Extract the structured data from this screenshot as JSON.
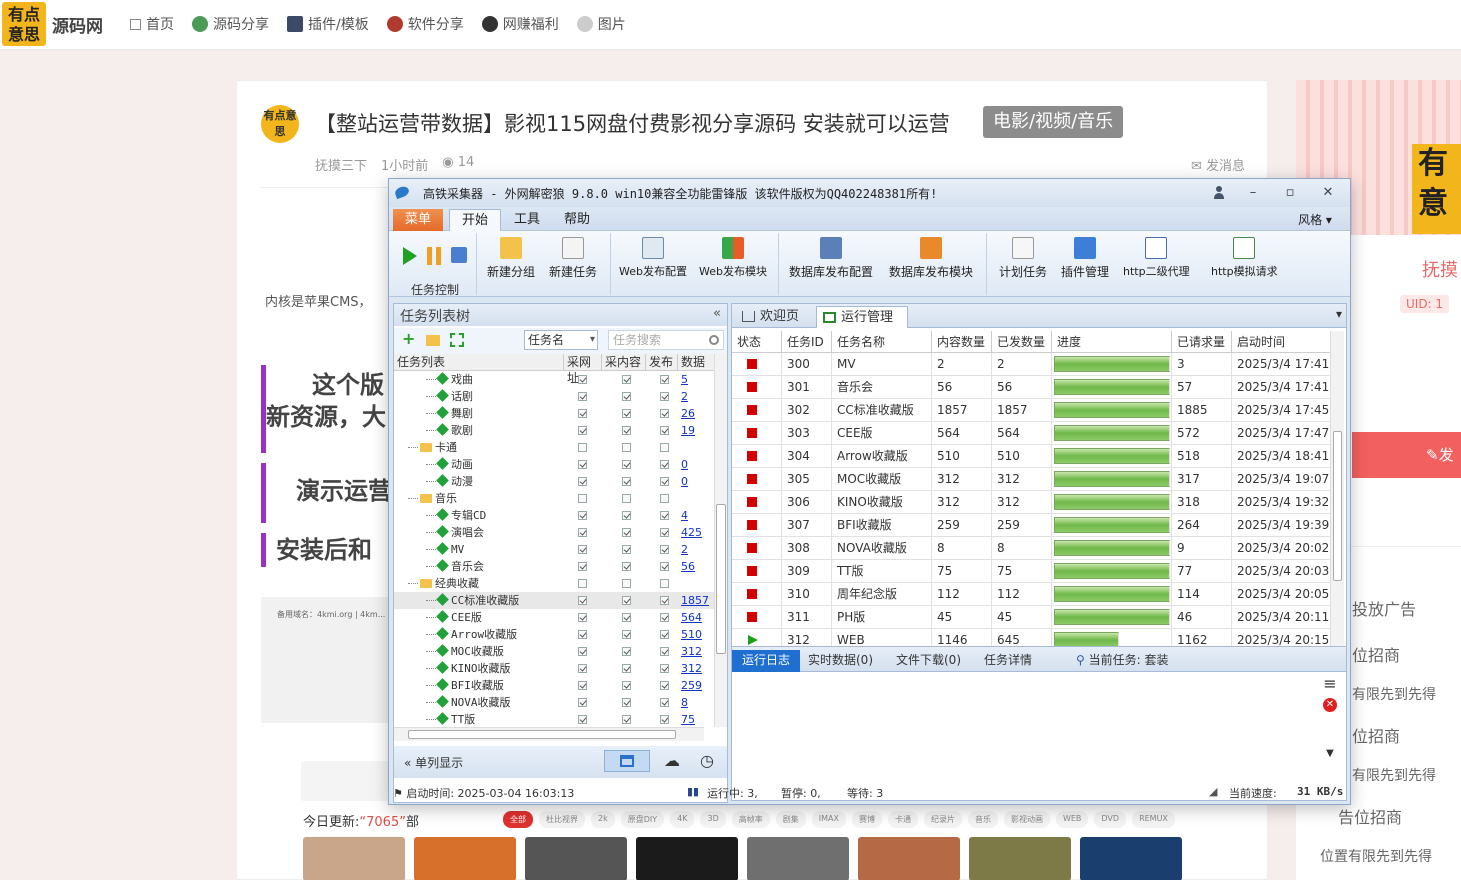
{
  "site": {
    "logo_text": "有点意思",
    "name": "源码网",
    "nav": [
      {
        "label": "首页",
        "icon": "home-icon"
      },
      {
        "label": "源码分享",
        "icon": "code-icon"
      },
      {
        "label": "插件/模板",
        "icon": "plugin-icon"
      },
      {
        "label": "软件分享",
        "icon": "software-icon"
      },
      {
        "label": "网赚福利",
        "icon": "gift-icon"
      },
      {
        "label": "图片",
        "icon": "image-icon"
      }
    ]
  },
  "article": {
    "title": "【整站运营带数据】影视115网盘付费影视分享源码 安装就可以运营",
    "tag": "电影/视频/音乐",
    "author": "抚摸三下",
    "time": "1小时前",
    "views": "14",
    "message": "发消息",
    "kernel_text": "内核是苹果CMS，",
    "headline1_line1": "这个版",
    "headline1_line2": "新资源，大",
    "headline2": "演示运营",
    "headline3": "安装后和",
    "img_caption": "备用域名：4kmi.org | 4km...",
    "today_label": "今日更新:",
    "today_count": "“7065”",
    "today_unit": "部",
    "chips": [
      "全部",
      "杜比视界",
      "2k",
      "原盘DIY",
      "4K",
      "3D",
      "高帧率",
      "剧集",
      "IMAX",
      "赛博",
      "卡通",
      "纪录片",
      "音乐",
      "影视动画",
      "WEB",
      "DVD",
      "REMUX"
    ]
  },
  "sidebar": {
    "name": "抚摸",
    "uid": "UID: 1",
    "post_btn": "发",
    "ads": [
      "投放广告",
      "位招商",
      "有限先到先得",
      "位招商",
      "有限先到先得",
      "告位招商",
      "位置有限先到先得"
    ]
  },
  "app": {
    "title": "高铁采集器 - 外网解密狼 9.8.0 win10兼容全功能雷锋版  该软件版权为QQ402248381所有!",
    "menu": {
      "menu": "菜单",
      "start": "开始",
      "tools": "工具",
      "help": "帮助",
      "style": "风格"
    },
    "ribbon": {
      "task_control": "任务控制",
      "new_group": "新建分组",
      "new_task": "新建任务",
      "web_config": "Web发布配置",
      "web_module": "Web发布模块",
      "db_config": "数据库发布配置",
      "db_module": "数据库发布模块",
      "schedule": "计划任务",
      "plugins": "插件管理",
      "http_proxy": "http二级代理",
      "http_sim": "http模拟请求"
    },
    "left": {
      "header": "任务列表树",
      "select": "任务名",
      "search_placeholder": "任务搜索",
      "cols": [
        "任务列表",
        "采网址",
        "采内容",
        "发布",
        "数据"
      ],
      "single_display": "单列显示",
      "start_time": "启动时间: 2025-03-04 16:03:13",
      "tree": [
        {
          "name": "戏曲",
          "level": 2,
          "folder": false,
          "c": [
            1,
            1,
            1
          ],
          "num": "5"
        },
        {
          "name": "话剧",
          "level": 2,
          "folder": false,
          "c": [
            1,
            1,
            1
          ],
          "num": "2"
        },
        {
          "name": "舞剧",
          "level": 2,
          "folder": false,
          "c": [
            1,
            1,
            1
          ],
          "num": "26"
        },
        {
          "name": "歌剧",
          "level": 2,
          "folder": false,
          "c": [
            1,
            1,
            1
          ],
          "num": "19"
        },
        {
          "name": "卡通",
          "level": 1,
          "folder": true,
          "c": [
            0,
            0,
            0
          ],
          "num": ""
        },
        {
          "name": "动画",
          "level": 2,
          "folder": false,
          "c": [
            1,
            1,
            1
          ],
          "num": "0"
        },
        {
          "name": "动漫",
          "level": 2,
          "folder": false,
          "c": [
            1,
            1,
            1
          ],
          "num": "0"
        },
        {
          "name": "音乐",
          "level": 1,
          "folder": true,
          "c": [
            0,
            0,
            0
          ],
          "num": ""
        },
        {
          "name": "专辑CD",
          "level": 2,
          "folder": false,
          "c": [
            1,
            1,
            1
          ],
          "num": "4"
        },
        {
          "name": "演唱会",
          "level": 2,
          "folder": false,
          "c": [
            1,
            1,
            1
          ],
          "num": "425"
        },
        {
          "name": "MV",
          "level": 2,
          "folder": false,
          "c": [
            1,
            1,
            1
          ],
          "num": "2"
        },
        {
          "name": "音乐会",
          "level": 2,
          "folder": false,
          "c": [
            1,
            1,
            1
          ],
          "num": "56"
        },
        {
          "name": "经典收藏",
          "level": 1,
          "folder": true,
          "c": [
            0,
            0,
            0
          ],
          "num": ""
        },
        {
          "name": "CC标准收藏版",
          "level": 2,
          "folder": false,
          "c": [
            1,
            1,
            1
          ],
          "num": "1857",
          "selected": true
        },
        {
          "name": "CEE版",
          "level": 2,
          "folder": false,
          "c": [
            1,
            1,
            1
          ],
          "num": "564"
        },
        {
          "name": "Arrow收藏版",
          "level": 2,
          "folder": false,
          "c": [
            1,
            1,
            1
          ],
          "num": "510"
        },
        {
          "name": "MOC收藏版",
          "level": 2,
          "folder": false,
          "c": [
            1,
            1,
            1
          ],
          "num": "312"
        },
        {
          "name": "KINO收藏版",
          "level": 2,
          "folder": false,
          "c": [
            1,
            1,
            1
          ],
          "num": "312"
        },
        {
          "name": "BFI收藏版",
          "level": 2,
          "folder": false,
          "c": [
            1,
            1,
            1
          ],
          "num": "259"
        },
        {
          "name": "NOVA收藏版",
          "level": 2,
          "folder": false,
          "c": [
            1,
            1,
            1
          ],
          "num": "8"
        },
        {
          "name": "TT版",
          "level": 2,
          "folder": false,
          "c": [
            1,
            1,
            1
          ],
          "num": "75"
        }
      ]
    },
    "right": {
      "tab_home": "欢迎页",
      "tab_run": "运行管理",
      "cols": [
        "状态",
        "任务ID",
        "任务名称",
        "内容数量",
        "已发数量",
        "进度",
        "已请求量",
        "启动时间"
      ],
      "rows": [
        {
          "status": "stopped",
          "id": "300",
          "name": "MV",
          "content": "2",
          "sent": "2",
          "progress": 1.0,
          "req": "3",
          "start": "2025/3/4 17:41:..."
        },
        {
          "status": "stopped",
          "id": "301",
          "name": "音乐会",
          "content": "56",
          "sent": "56",
          "progress": 1.0,
          "req": "57",
          "start": "2025/3/4 17:41:..."
        },
        {
          "status": "stopped",
          "id": "302",
          "name": "CC标准收藏版",
          "content": "1857",
          "sent": "1857",
          "progress": 1.0,
          "req": "1885",
          "start": "2025/3/4 17:45:..."
        },
        {
          "status": "stopped",
          "id": "303",
          "name": "CEE版",
          "content": "564",
          "sent": "564",
          "progress": 1.0,
          "req": "572",
          "start": "2025/3/4 17:47:..."
        },
        {
          "status": "stopped",
          "id": "304",
          "name": "Arrow收藏版",
          "content": "510",
          "sent": "510",
          "progress": 1.0,
          "req": "518",
          "start": "2025/3/4 18:41:..."
        },
        {
          "status": "stopped",
          "id": "305",
          "name": "MOC收藏版",
          "content": "312",
          "sent": "312",
          "progress": 1.0,
          "req": "317",
          "start": "2025/3/4 19:07:..."
        },
        {
          "status": "stopped",
          "id": "306",
          "name": "KINO收藏版",
          "content": "312",
          "sent": "312",
          "progress": 1.0,
          "req": "318",
          "start": "2025/3/4 19:32:..."
        },
        {
          "status": "stopped",
          "id": "307",
          "name": "BFI收藏版",
          "content": "259",
          "sent": "259",
          "progress": 1.0,
          "req": "264",
          "start": "2025/3/4 19:39:..."
        },
        {
          "status": "stopped",
          "id": "308",
          "name": "NOVA收藏版",
          "content": "8",
          "sent": "8",
          "progress": 1.0,
          "req": "9",
          "start": "2025/3/4 20:02:..."
        },
        {
          "status": "stopped",
          "id": "309",
          "name": "TT版",
          "content": "75",
          "sent": "75",
          "progress": 1.0,
          "req": "77",
          "start": "2025/3/4 20:03:..."
        },
        {
          "status": "stopped",
          "id": "310",
          "name": "周年纪念版",
          "content": "112",
          "sent": "112",
          "progress": 1.0,
          "req": "114",
          "start": "2025/3/4 20:05:..."
        },
        {
          "status": "stopped",
          "id": "311",
          "name": "PH版",
          "content": "45",
          "sent": "45",
          "progress": 1.0,
          "req": "46",
          "start": "2025/3/4 20:11:..."
        },
        {
          "status": "running",
          "id": "312",
          "name": "WEB",
          "content": "1146",
          "sent": "645",
          "progress": 0.56,
          "req": "1162",
          "start": "2025/3/4 20:15:..."
        }
      ],
      "log_tabs": {
        "log": "运行日志",
        "realtime": "实时数据(0)",
        "download": "文件下载(0)",
        "detail": "任务详情",
        "current": "当前任务: 套装"
      },
      "status": {
        "running": "运行中: 3,",
        "paused": "暂停: 0,",
        "waiting": "等待: 3",
        "speed_label": "当前速度:",
        "speed": "31 KB/s"
      }
    }
  }
}
